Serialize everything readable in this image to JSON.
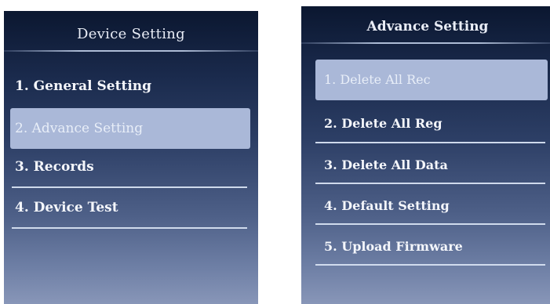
{
  "left_screen": {
    "title": "Device Setting",
    "items": [
      {
        "label": "1. General Setting",
        "selected": false
      },
      {
        "label": "2. Advance Setting",
        "selected": true
      },
      {
        "label": "3. Records",
        "selected": false
      },
      {
        "label": "4. Device Test",
        "selected": false
      }
    ]
  },
  "right_screen": {
    "title": "Advance Setting",
    "items": [
      {
        "label": "1. Delete All Rec",
        "selected": true
      },
      {
        "label": "2. Delete All Reg",
        "selected": false
      },
      {
        "label": "3. Delete All Data",
        "selected": false
      },
      {
        "label": "4. Default Setting",
        "selected": false
      },
      {
        "label": "5. Upload Firmware",
        "selected": false
      }
    ]
  },
  "colors": {
    "selection_highlight": "#aab8d8",
    "menu_text": "#f4f6fb",
    "screen_top": "#0b1730",
    "screen_bottom": "#8896b8"
  }
}
